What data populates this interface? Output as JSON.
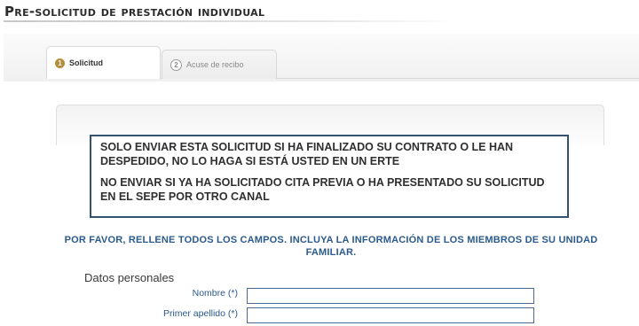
{
  "page": {
    "title": "Pre-solicitud de prestación individual"
  },
  "tabs": [
    {
      "number": "1",
      "label": "Solicitud",
      "active": true
    },
    {
      "number": "2",
      "label": "Acuse de recibo",
      "active": false
    }
  ],
  "notice": {
    "line1": "SOLO ENVIAR ESTA SOLICITUD SI HA FINALIZADO SU CONTRATO O LE HAN DESPEDIDO, NO LO HAGA SI ESTÁ USTED EN UN ERTE",
    "line2": "NO ENVIAR SI YA HA SOLICITADO CITA PREVIA O HA PRESENTADO SU SOLICITUD EN EL SEPE POR OTRO CANAL"
  },
  "instructions": "POR FAVOR, RELLENE TODOS LOS CAMPOS. INCLUYA LA INFORMACIÓN DE LOS MIEMBROS DE SU UNIDAD FAMILIAR.",
  "form": {
    "section_title": "Datos personales",
    "required_marker": "(*)",
    "fields": [
      {
        "label": "Nombre",
        "value": ""
      },
      {
        "label": "Primer apellido",
        "value": ""
      }
    ]
  },
  "colors": {
    "accent": "#2b5a8c",
    "notice_border": "#33526d",
    "active_step": "#b58c3c"
  }
}
